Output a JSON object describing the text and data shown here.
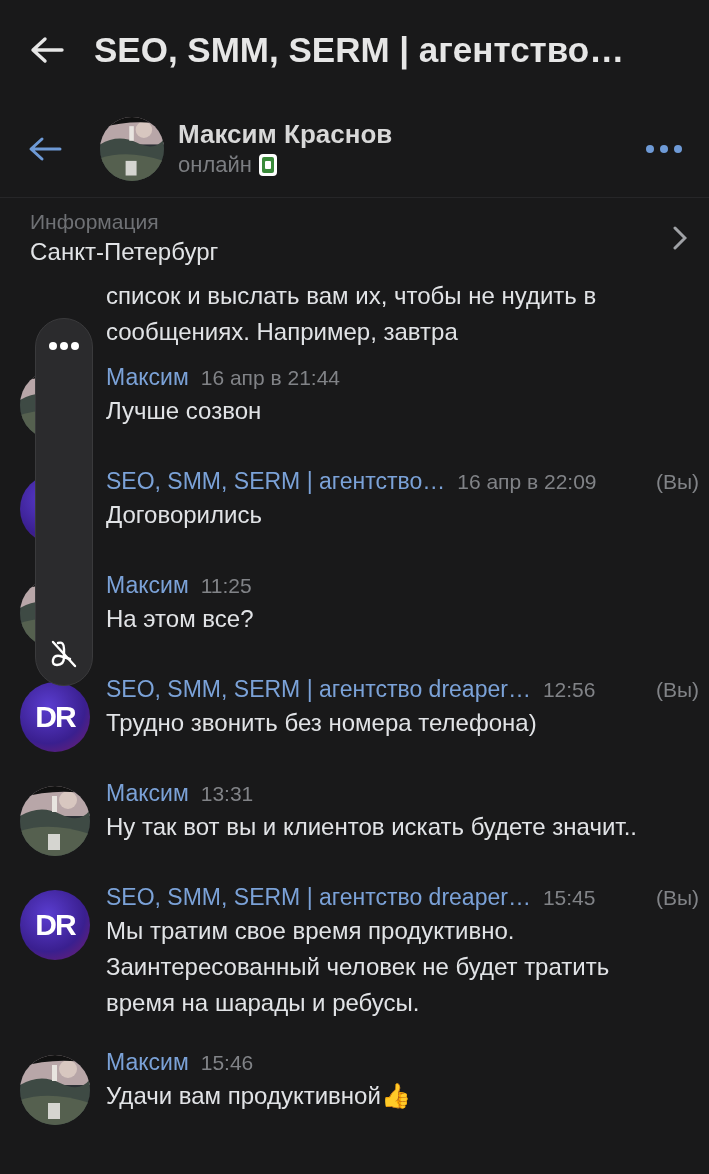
{
  "top_bar": {
    "title": "SEO, SMM, SERM | агентство…"
  },
  "contact": {
    "name": "Максим Краснов",
    "status": "онлайн",
    "mobile": true
  },
  "info": {
    "label": "Информация",
    "value": "Санкт-Петербург"
  },
  "messages": [
    {
      "kind": "fragment",
      "lines": [
        "список и выслать вам их, чтобы не нудить в",
        "сообщениях. Например, завтра"
      ]
    },
    {
      "kind": "message",
      "author": "Максим",
      "time": "16 апр в 21:44",
      "text": "Лучше созвон"
    },
    {
      "kind": "message",
      "avatar": {
        "kind": "logo"
      },
      "author": "SEO, SMM, SERM | агентство…",
      "time": "16 апр в 22:09",
      "you": "(Вы)",
      "text": "Договорились"
    },
    {
      "kind": "message",
      "author": "Максим",
      "time": "11:25",
      "text": "На этом все?"
    },
    {
      "kind": "message",
      "avatar": {
        "kind": "logo",
        "text": "DR"
      },
      "author": "SEO, SMM, SERM | агентство dreaper…",
      "time": "12:56",
      "you": "(Вы)",
      "text": "Трудно звонить без номера телефона)"
    },
    {
      "kind": "message",
      "author": "Максим",
      "time": "13:31",
      "text": "Ну так вот вы и клиентов искать будете значит.."
    },
    {
      "kind": "message",
      "avatar": {
        "kind": "logo",
        "text": "DR"
      },
      "author": "SEO, SMM, SERM | агентство dreaper…",
      "time": "15:45",
      "you": "(Вы)",
      "text": "Мы тратим свое время продуктивно. Заинтересованный человек не будет тратить время на шарады и ребусы."
    },
    {
      "kind": "message",
      "author": "Максим",
      "time": "15:46",
      "text": "Удачи вам продуктивной👍"
    }
  ]
}
